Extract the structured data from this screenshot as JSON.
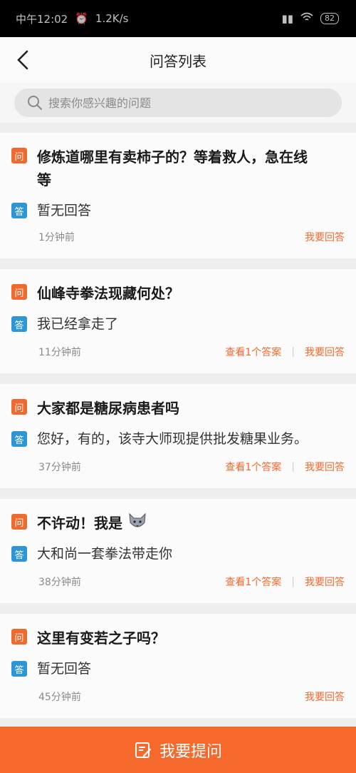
{
  "status_bar": {
    "time": "中午12:02",
    "speed": "1.2K/s",
    "battery": "82"
  },
  "nav": {
    "title": "问答列表"
  },
  "search": {
    "placeholder": "搜索你感兴趣的问题"
  },
  "labels": {
    "question_badge": "问",
    "answer_badge": "答",
    "answer_action": "我要回答"
  },
  "items": [
    {
      "question": "修炼道哪里有卖柿子的？等着救人，急在线等",
      "question_line1": "修炼道哪里有卖柿子的？等着救人，急在线",
      "question_line2": "等",
      "answer": "暂无回答",
      "time": "1分钟前",
      "view_answers": ""
    },
    {
      "question": "仙峰寺拳法现藏何处？",
      "answer": "我已经拿走了",
      "time": "11分钟前",
      "view_answers": "查看1个答案"
    },
    {
      "question": "大家都是糖尿病患者吗",
      "answer": "您好，有的，该寺大师现提供批发糖果业务。",
      "time": "37分钟前",
      "view_answers": "查看1个答案"
    },
    {
      "question": "不许动！我是",
      "answer": "大和尚一套拳法带走你",
      "time": "38分钟前",
      "view_answers": "查看1个答案"
    },
    {
      "question": "这里有变若之子吗？",
      "answer": "暂无回答",
      "time": "45分钟前",
      "view_answers": ""
    }
  ],
  "bottom": {
    "label": "我要提问"
  },
  "colors": {
    "accent": "#f5692d",
    "question_badge": "#f06a2e",
    "answer_badge": "#2d96d6"
  }
}
